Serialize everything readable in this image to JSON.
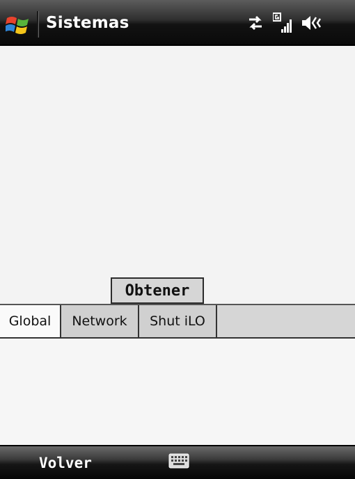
{
  "titlebar": {
    "title": "Sistemas",
    "icons": [
      "windows-start-icon",
      "sync-arrows-icon",
      "signal-strength-icon",
      "speaker-muted-icon"
    ]
  },
  "actions": {
    "obtener_label": "Obtener"
  },
  "tabs": [
    {
      "label": "Global",
      "active": true
    },
    {
      "label": "Network",
      "active": false
    },
    {
      "label": "Shut iLO",
      "active": false
    }
  ],
  "softkeys": {
    "left_label": "Volver",
    "center_icon": "keyboard-icon"
  },
  "colors": {
    "titlebar_dark": "#121212",
    "content_bg": "#f3f3f3",
    "tab_inactive_bg": "#d0d0d0",
    "button_bg": "#d6d6d6"
  }
}
